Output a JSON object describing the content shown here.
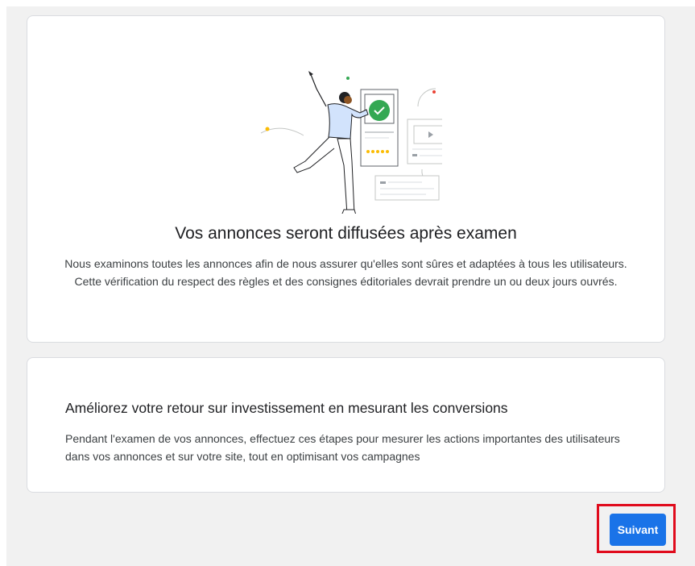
{
  "review_card": {
    "title": "Vos annonces seront diffusées après examen",
    "description": "Nous examinons toutes les annonces afin de nous assurer qu'elles sont sûres et adaptées à tous les utilisateurs. Cette vérification du respect des règles et des consignes éditoriales devrait prendre un ou deux jours ouvrés."
  },
  "conversions_card": {
    "title": "Améliorez votre retour sur investissement en mesurant les conversions",
    "description": "Pendant l'examen de vos annonces, effectuez ces étapes pour mesurer les actions importantes des utilisateurs dans vos annonces et sur votre site, tout en optimisant vos campagnes"
  },
  "actions": {
    "next_label": "Suivant"
  },
  "colors": {
    "primary": "#1a73e8",
    "highlight": "#e00b1c",
    "check_green": "#34a853",
    "star_yellow": "#fbbc04",
    "dot_red": "#ea4335",
    "background": "#f1f1f1"
  },
  "icons": {
    "illustration": "ad-review-celebration-illustration",
    "check": "check-icon",
    "play": "play-icon"
  }
}
